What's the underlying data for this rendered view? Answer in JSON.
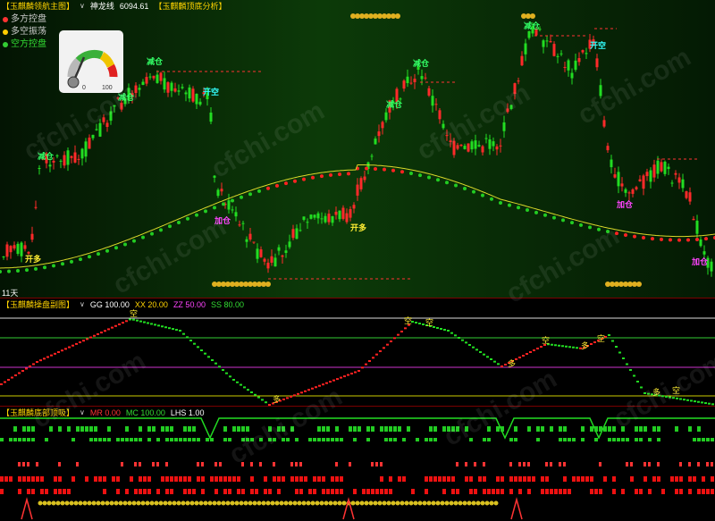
{
  "main_panel": {
    "title": "【玉麒麟领航主图】",
    "indicator_name": "神龙线",
    "indicator_value": "6094.61",
    "sub_title": "【玉麒麟顶底分析】",
    "legend": [
      {
        "label": "多方控盘",
        "color": "#ff3333"
      },
      {
        "label": "多空振荡",
        "color": "#ffcc00"
      },
      {
        "label": "空方控盘",
        "color": "#33cc33"
      }
    ],
    "gauge": {
      "min_label": "0",
      "max_label": "100",
      "value": 0.35
    },
    "period_label": "11天",
    "annotations": {
      "reduce": "减仓",
      "open_short": "开空",
      "open_long": "开多",
      "add": "加仓"
    }
  },
  "sub_panel_1": {
    "title": "【玉麒麟操盘副图】",
    "params": [
      {
        "label": "GG 100.00",
        "color": "#ffffff"
      },
      {
        "label": "XX 20.00",
        "color": "#ffd400"
      },
      {
        "label": "ZZ 50.00",
        "color": "#ff44ff"
      },
      {
        "label": "SS 80.00",
        "color": "#33dd33"
      }
    ],
    "marker_short": "空",
    "marker_long": "多"
  },
  "sub_panel_2": {
    "title": "【玉麒麟底部顶吸】",
    "params": [
      {
        "label": "MR 0.00",
        "color": "#ff3333"
      },
      {
        "label": "MC 100.00",
        "color": "#33dd33"
      },
      {
        "label": "LHS 1.00",
        "color": "#ffffff"
      }
    ]
  },
  "watermark": "cfchi.com"
}
